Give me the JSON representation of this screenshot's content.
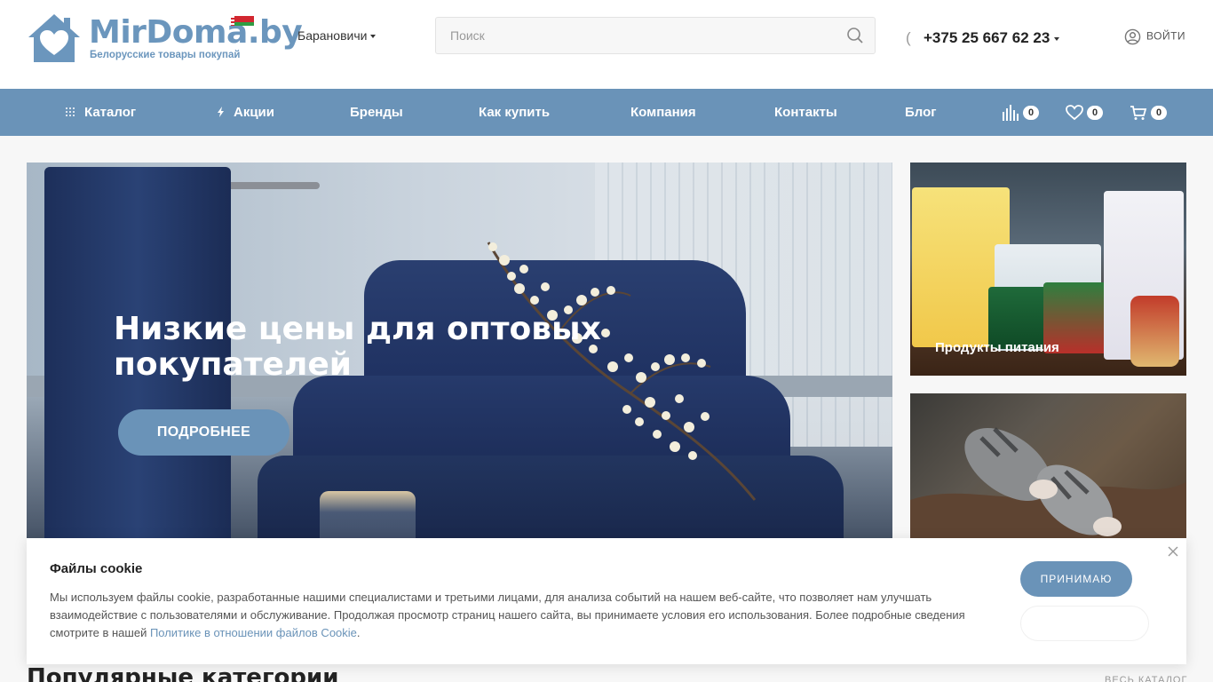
{
  "header": {
    "logo_brand": "MirDoma.by",
    "logo_tagline": "Белорусские товары покупай",
    "city": "Барановичи",
    "search_placeholder": "Поиск",
    "phone": "+375 25 667 62 23",
    "login_label": "ВОЙТИ"
  },
  "nav": {
    "items": [
      {
        "label": "Каталог",
        "icon": "grid-icon"
      },
      {
        "label": "Акции",
        "icon": "lightning-icon"
      },
      {
        "label": "Бренды"
      },
      {
        "label": "Как купить"
      },
      {
        "label": "Компания"
      },
      {
        "label": "Контакты"
      },
      {
        "label": "Блог"
      }
    ],
    "compare_count": "0",
    "favorites_count": "0",
    "cart_count": "0"
  },
  "banner": {
    "title": "Низкие цены для оптовых покупателей",
    "button": "ПОДРОБНЕЕ"
  },
  "tiles": [
    {
      "label": "Продукты питания"
    },
    {
      "label": ""
    }
  ],
  "cookie": {
    "title": "Файлы cookie",
    "text": "Мы используем файлы cookie, разработанные нашими специалистами и третьими лицами, для анализа событий на нашем веб-сайте, что позволяет нам улучшать взаимодействие с пользователями и обслуживание. Продолжая просмотр страниц нашего сайта, вы принимаете условия его использования. Более подробные сведения смотрите в нашей ",
    "link": "Политике в отношении файлов Cookie",
    "after_link": ".",
    "accept": "ПРИНИМАЮ"
  },
  "section": {
    "title": "Популярные категории",
    "all_link": "ВЕСЬ КАТАЛОГ"
  },
  "colors": {
    "accent": "#6a93b8",
    "header_bg": "#ffffff",
    "page_bg": "#f7f7f7"
  }
}
